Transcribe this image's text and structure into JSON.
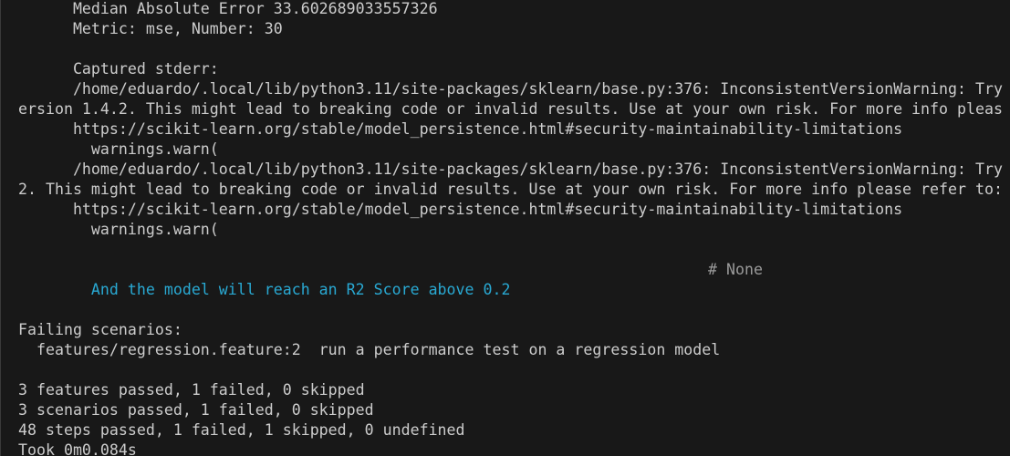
{
  "terminal": {
    "lines": [
      "      Median Absolute Error 33.602689033557326",
      "      Metric: mse, Number: 30",
      "",
      "      Captured stderr:",
      "      /home/eduardo/.local/lib/python3.11/site-packages/sklearn/base.py:376: InconsistentVersionWarning: Try",
      "ersion 1.4.2. This might lead to breaking code or invalid results. Use at your own risk. For more info pleas",
      "      https://scikit-learn.org/stable/model_persistence.html#security-maintainability-limitations",
      "        warnings.warn(",
      "      /home/eduardo/.local/lib/python3.11/site-packages/sklearn/base.py:376: InconsistentVersionWarning: Try",
      "2. This might lead to breaking code or invalid results. Use at your own risk. For more info please refer to:",
      "      https://scikit-learn.org/stable/model_persistence.html#security-maintainability-limitations",
      "        warnings.warn("
    ],
    "step": {
      "text": "    And the model will reach an R2 Score above 0.2",
      "comment": "# None"
    },
    "summary_lines": [
      "Failing scenarios:",
      "  features/regression.feature:2  run a performance test on a regression model",
      "",
      "3 features passed, 1 failed, 0 skipped",
      "3 scenarios passed, 1 failed, 0 skipped",
      "48 steps passed, 1 failed, 1 skipped, 0 undefined",
      "Took 0m0.084s"
    ]
  },
  "colors": {
    "background": "#181818",
    "text": "#cccccc",
    "step": "#29a9d3",
    "comment": "#9a9a9a"
  }
}
